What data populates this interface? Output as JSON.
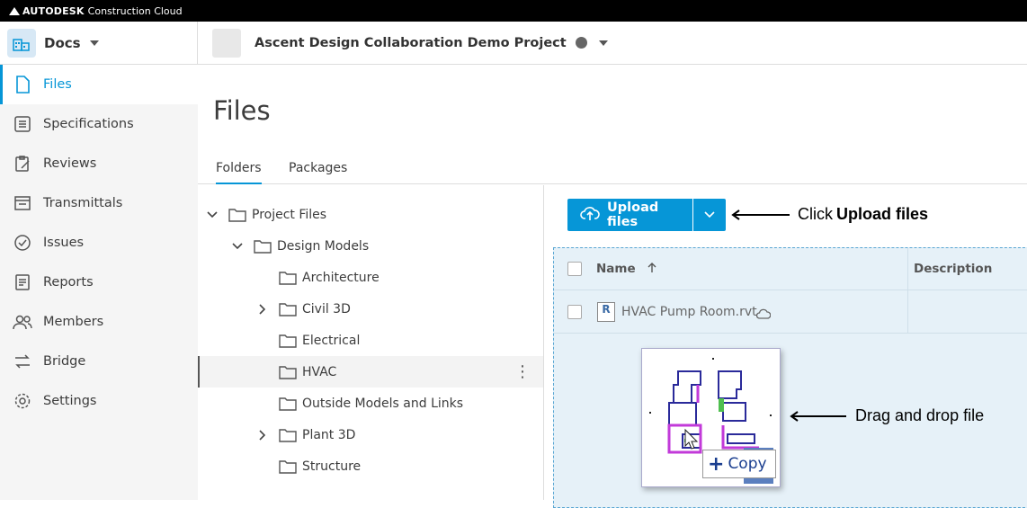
{
  "topbar": {
    "brand": "AUTODESK",
    "product": "Construction Cloud"
  },
  "header": {
    "module": "Docs",
    "project": "Ascent Design Collaboration Demo Project"
  },
  "sidebar": {
    "items": [
      {
        "label": "Files",
        "icon": "file-icon",
        "active": true
      },
      {
        "label": "Specifications",
        "icon": "specifications-icon"
      },
      {
        "label": "Reviews",
        "icon": "reviews-icon"
      },
      {
        "label": "Transmittals",
        "icon": "transmittals-icon"
      },
      {
        "label": "Issues",
        "icon": "issues-icon"
      },
      {
        "label": "Reports",
        "icon": "reports-icon"
      },
      {
        "label": "Members",
        "icon": "members-icon"
      },
      {
        "label": "Bridge",
        "icon": "bridge-icon"
      },
      {
        "label": "Settings",
        "icon": "settings-icon"
      }
    ]
  },
  "page": {
    "title": "Files"
  },
  "tabs": {
    "folders": "Folders",
    "packages": "Packages"
  },
  "tree": {
    "items": [
      {
        "label": "Project Files",
        "expanded": true
      },
      {
        "label": "Design Models",
        "expanded": true
      },
      {
        "label": "Architecture"
      },
      {
        "label": "Civil 3D",
        "collapsed": true
      },
      {
        "label": "Electrical"
      },
      {
        "label": "HVAC",
        "selected": true
      },
      {
        "label": "Outside Models and Links"
      },
      {
        "label": "Plant 3D",
        "collapsed": true
      },
      {
        "label": "Structure"
      }
    ]
  },
  "toolbar": {
    "upload_label": "Upload files"
  },
  "grid": {
    "columns": {
      "name": "Name",
      "description": "Description"
    },
    "rows": [
      {
        "name": "HVAC Pump Room.rvt",
        "file_icon": "R"
      }
    ]
  },
  "drag": {
    "copy_label": "Copy"
  },
  "callouts": {
    "upload_prefix": "Click ",
    "upload_bold": "Upload files",
    "drag": "Drag and drop file"
  },
  "colors": {
    "accent": "#0696d7",
    "drop_zone": "#e6f1f8"
  }
}
